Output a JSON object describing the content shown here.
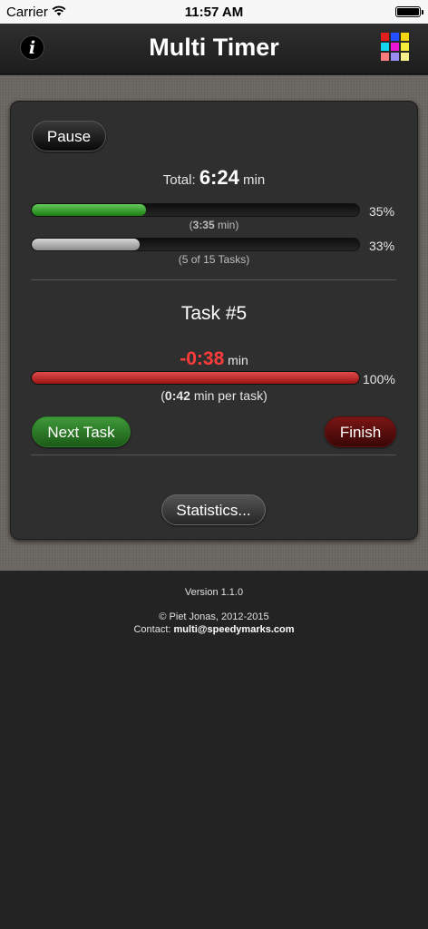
{
  "status_bar": {
    "carrier": "Carrier",
    "time": "11:57 AM"
  },
  "nav": {
    "title": "Multi Timer",
    "info_label": "i",
    "grid_colors": [
      "#e21e1e",
      "#2550ff",
      "#f5d60f",
      "#13d6f0",
      "#e917d1",
      "#f8ec3a",
      "#fb7c7c",
      "#9a8cf5",
      "#f9f08a"
    ]
  },
  "timer": {
    "pause_label": "Pause",
    "total_prefix": "Total:",
    "total_value": "6:24",
    "total_unit": "min",
    "time_progress_pct": "35%",
    "time_progress_fraction": 0.35,
    "time_elapsed_open": "(",
    "time_elapsed_value": "3:35",
    "time_elapsed_close": " min)",
    "tasks_progress_pct": "33%",
    "tasks_progress_fraction": 0.33,
    "tasks_label": "(5 of 15 Tasks)",
    "task_title": "Task #5",
    "task_remaining_value": "-0:38",
    "task_remaining_unit": "min",
    "task_progress_pct": "100%",
    "task_progress_fraction": 1.0,
    "per_task_open": "(",
    "per_task_value": "0:42",
    "per_task_close": " min per task)",
    "next_task_label": "Next Task",
    "finish_label": "Finish",
    "statistics_label": "Statistics..."
  },
  "footer": {
    "version": "Version 1.1.0",
    "copyright": "© Piet Jonas, 2012-2015",
    "contact_prefix": "Contact:",
    "contact_email": "multi@speedymarks.com"
  }
}
